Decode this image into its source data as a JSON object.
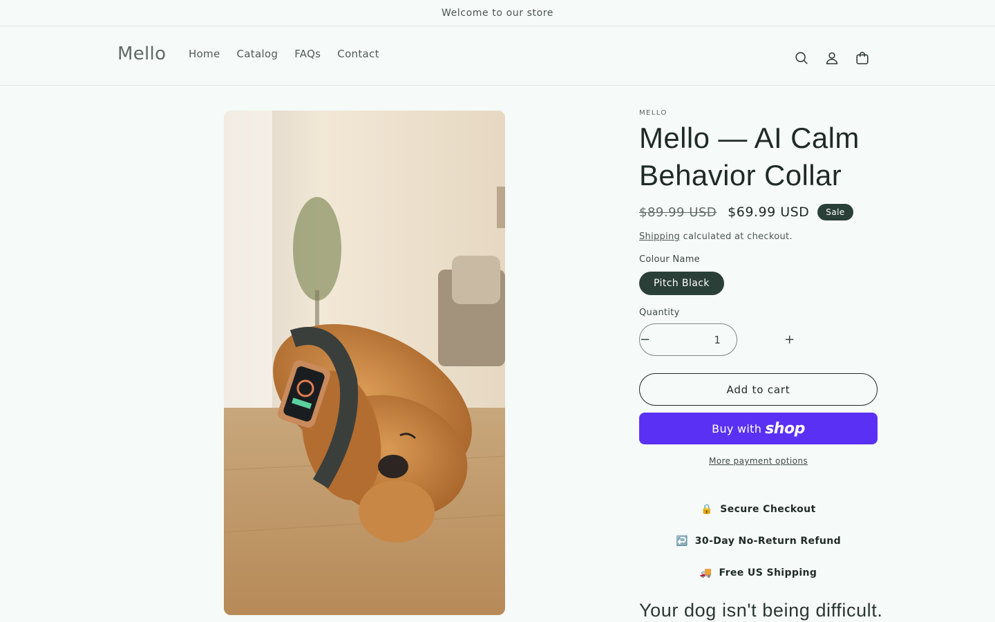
{
  "announcement": "Welcome to our store",
  "header": {
    "logo": "Mello",
    "nav": [
      "Home",
      "Catalog",
      "FAQs",
      "Contact"
    ],
    "icons": [
      "search-icon",
      "account-icon",
      "cart-icon"
    ]
  },
  "product": {
    "vendor": "MELLO",
    "title": "Mello — AI Calm Behavior Collar",
    "compare_price": "$89.99 USD",
    "price": "$69.99 USD",
    "badge": "Sale",
    "shipping_link": "Shipping",
    "shipping_note": " calculated at checkout.",
    "colour_label": "Colour Name",
    "colour_value": "Pitch Black",
    "quantity_label": "Quantity",
    "quantity_value": "1",
    "minus": "−",
    "plus": "+",
    "add_to_cart": "Add to cart",
    "buy_with": "Buy with",
    "shop_brand": "shop",
    "more_payment": "More payment options",
    "perks": [
      {
        "icon": "🔒",
        "label": "Secure Checkout"
      },
      {
        "icon": "↩️",
        "label": "30-Day No-Return Refund"
      },
      {
        "icon": "🚚",
        "label": "Free US Shipping"
      }
    ],
    "tagline": "Your dog isn't being difficult."
  },
  "colors": {
    "background": "#f6faf8",
    "accent": "#2a3f37",
    "shop_pay": "#5a31f4"
  }
}
